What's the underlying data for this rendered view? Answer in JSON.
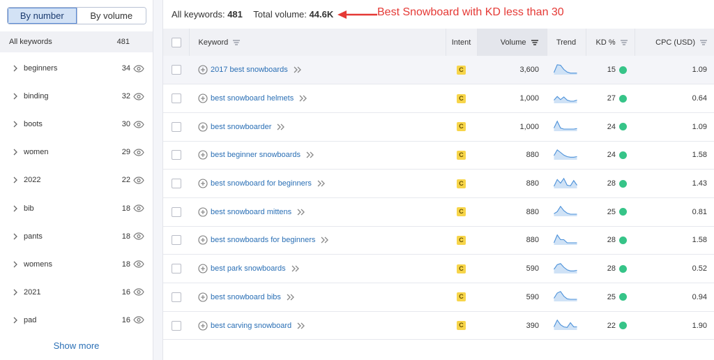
{
  "colors": {
    "accent": "#2a6fb5",
    "annotation": "#e53935",
    "kd_easy": "#36c488",
    "intent_commercial": "#f7d54a"
  },
  "sidebar": {
    "toggle": {
      "by_number": "By number",
      "by_volume": "By volume"
    },
    "all": {
      "label": "All keywords",
      "count": "481"
    },
    "groups": [
      {
        "label": "beginners",
        "count": "34"
      },
      {
        "label": "binding",
        "count": "32"
      },
      {
        "label": "boots",
        "count": "30"
      },
      {
        "label": "women",
        "count": "29"
      },
      {
        "label": "2022",
        "count": "22"
      },
      {
        "label": "bib",
        "count": "18"
      },
      {
        "label": "pants",
        "count": "18"
      },
      {
        "label": "womens",
        "count": "18"
      },
      {
        "label": "2021",
        "count": "16"
      },
      {
        "label": "pad",
        "count": "16"
      }
    ],
    "show_more": "Show more"
  },
  "summary": {
    "all_label": "All keywords:",
    "all_value": "481",
    "volume_label": "Total volume:",
    "volume_value": "44.6K",
    "annotation": "Best Snowboard with KD less than 30"
  },
  "table": {
    "headers": {
      "keyword": "Keyword",
      "intent": "Intent",
      "volume": "Volume",
      "trend": "Trend",
      "kd": "KD %",
      "cpc": "CPC (USD)"
    },
    "rows": [
      {
        "keyword": "2017 best snowboards",
        "intent": "C",
        "volume": "3,600",
        "kd": "15",
        "cpc": "1.09",
        "trend": [
          0.2,
          0.95,
          0.9,
          0.5,
          0.25,
          0.15,
          0.15,
          0.15
        ]
      },
      {
        "keyword": "best snowboard helmets",
        "intent": "C",
        "volume": "1,000",
        "kd": "27",
        "cpc": "0.64",
        "trend": [
          0.3,
          0.65,
          0.35,
          0.6,
          0.3,
          0.2,
          0.2,
          0.3
        ]
      },
      {
        "keyword": "best snowboarder",
        "intent": "C",
        "volume": "1,000",
        "kd": "24",
        "cpc": "1.09",
        "trend": [
          0.3,
          0.95,
          0.3,
          0.2,
          0.2,
          0.2,
          0.2,
          0.25
        ]
      },
      {
        "keyword": "best beginner snowboards",
        "intent": "C",
        "volume": "880",
        "kd": "24",
        "cpc": "1.58",
        "trend": [
          0.4,
          0.95,
          0.7,
          0.45,
          0.3,
          0.25,
          0.25,
          0.3
        ]
      },
      {
        "keyword": "best snowboard for beginners",
        "intent": "C",
        "volume": "880",
        "kd": "28",
        "cpc": "1.43",
        "trend": [
          0.2,
          0.85,
          0.5,
          0.95,
          0.3,
          0.25,
          0.75,
          0.3
        ]
      },
      {
        "keyword": "best snowboard mittens",
        "intent": "C",
        "volume": "880",
        "kd": "25",
        "cpc": "0.81",
        "trend": [
          0.25,
          0.45,
          0.95,
          0.55,
          0.3,
          0.2,
          0.2,
          0.2
        ]
      },
      {
        "keyword": "best snowboards for beginners",
        "intent": "C",
        "volume": "880",
        "kd": "28",
        "cpc": "1.58",
        "trend": [
          0.2,
          0.95,
          0.5,
          0.5,
          0.2,
          0.2,
          0.2,
          0.2
        ]
      },
      {
        "keyword": "best park snowboards",
        "intent": "C",
        "volume": "590",
        "kd": "28",
        "cpc": "0.52",
        "trend": [
          0.4,
          0.85,
          0.95,
          0.6,
          0.35,
          0.25,
          0.25,
          0.3
        ]
      },
      {
        "keyword": "best snowboard bibs",
        "intent": "C",
        "volume": "590",
        "kd": "25",
        "cpc": "0.94",
        "trend": [
          0.3,
          0.8,
          0.95,
          0.5,
          0.25,
          0.2,
          0.2,
          0.2
        ]
      },
      {
        "keyword": "best carving snowboard",
        "intent": "C",
        "volume": "390",
        "kd": "22",
        "cpc": "1.90",
        "trend": [
          0.3,
          0.95,
          0.5,
          0.3,
          0.25,
          0.7,
          0.3,
          0.3
        ]
      }
    ]
  }
}
